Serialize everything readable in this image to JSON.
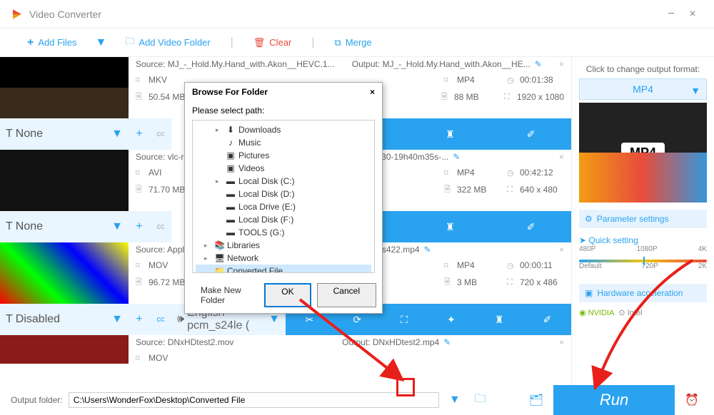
{
  "app": {
    "title": "Video Converter"
  },
  "toolbar": {
    "add_files": "Add Files",
    "add_folder": "Add Video Folder",
    "clear": "Clear",
    "merge": "Merge"
  },
  "items": [
    {
      "source": "MJ_-_Hold.My.Hand_with.Akon__HEVC.1...",
      "output": "MJ_-_Hold.My.Hand_with.Akon__HE...",
      "src_format": "MKV",
      "src_size": "50.54 MB",
      "out_format": "MP4",
      "out_size": "88 MB",
      "src_dur": "",
      "src_res": "",
      "out_dur": "00:01:38",
      "out_res": "1920 x 1080",
      "subtitle": "None"
    },
    {
      "source": "vlc-re",
      "output": "vlc-record-2017-10-30-19h40m35s-...",
      "src_format": "AVI",
      "src_size": "71.70 MB",
      "out_format": "MP4",
      "out_size": "322 MB",
      "out_dur": "00:42:12",
      "out_res": "640 x 480",
      "subtitle": "None"
    },
    {
      "source": "Apple",
      "output": "AppleProRes422.mp4",
      "src_format": "MOV",
      "src_size": "96.72 MB",
      "out_format": "MP4",
      "out_size": "3 MB",
      "out_dur": "00:00:11",
      "out_res": "720 x 486",
      "subtitle": "Disabled",
      "audio": "English pcm_s24le ("
    },
    {
      "source": "DNxHDtest2.mov",
      "output": "DNxHDtest2.mp4",
      "src_format": "MOV"
    }
  ],
  "labels": {
    "source_prefix": "Source: ",
    "output_prefix": "Output: "
  },
  "right": {
    "format_hint": "Click to change output format:",
    "format": "MP4",
    "format_img_label": "MP4",
    "param_settings": "Parameter settings",
    "quick_setting": "Quick setting",
    "scale_top": [
      "480P",
      "1080P",
      "4K"
    ],
    "scale_bottom": [
      "Default",
      "720P",
      "2K"
    ],
    "hw_accel": "Hardware acceleration",
    "brands": [
      "NVIDIA",
      "Intel"
    ]
  },
  "bottom": {
    "label": "Output folder:",
    "path": "C:\\Users\\WonderFox\\Desktop\\Converted File",
    "run": "Run"
  },
  "dialog": {
    "title": "Browse For Folder",
    "prompt": "Please select path:",
    "tree": [
      {
        "icon": "⬇",
        "label": "Downloads",
        "indent": 1,
        "exp": "▸"
      },
      {
        "icon": "♪",
        "label": "Music",
        "indent": 1,
        "exp": ""
      },
      {
        "icon": "▣",
        "label": "Pictures",
        "indent": 1,
        "exp": ""
      },
      {
        "icon": "▣",
        "label": "Videos",
        "indent": 1,
        "exp": ""
      },
      {
        "icon": "▬",
        "label": "Local Disk (C:)",
        "indent": 1,
        "exp": "▸"
      },
      {
        "icon": "▬",
        "label": "Local Disk (D:)",
        "indent": 1,
        "exp": ""
      },
      {
        "icon": "▬",
        "label": "Loca Drive (E:)",
        "indent": 1,
        "exp": ""
      },
      {
        "icon": "▬",
        "label": "Local Disk (F:)",
        "indent": 1,
        "exp": ""
      },
      {
        "icon": "▬",
        "label": "TOOLS (G:)",
        "indent": 1,
        "exp": ""
      },
      {
        "icon": "📚",
        "label": "Libraries",
        "indent": 0,
        "exp": "▸"
      },
      {
        "icon": "🖥",
        "label": "Network",
        "indent": 0,
        "exp": "▸"
      },
      {
        "icon": "📁",
        "label": "Converted File",
        "indent": 0,
        "sel": true,
        "exp": ""
      }
    ],
    "make_folder": "Make New Folder",
    "ok": "OK",
    "cancel": "Cancel"
  }
}
